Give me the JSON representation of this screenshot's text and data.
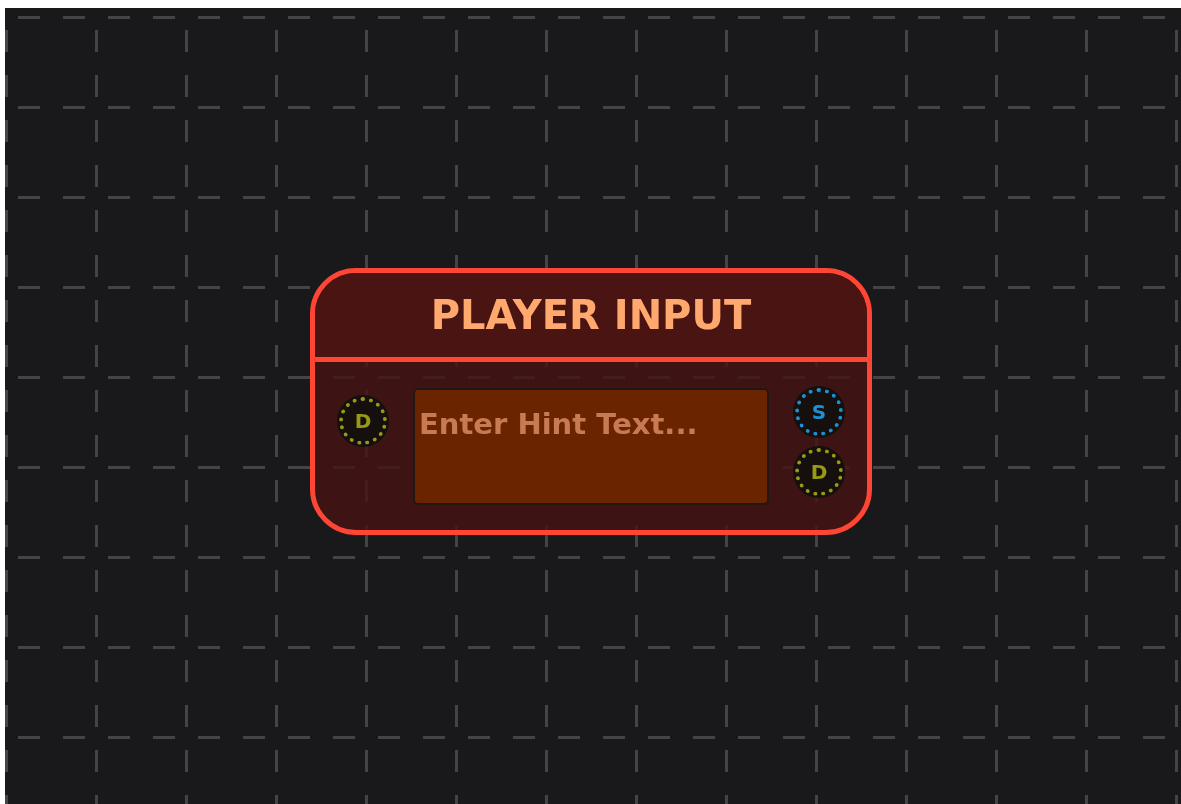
{
  "node": {
    "title": "PLAYER INPUT",
    "input": {
      "placeholder": "Enter Hint Text..."
    },
    "inputs": [
      {
        "label": "D",
        "kind": "data"
      }
    ],
    "outputs": [
      {
        "label": "S",
        "kind": "signal"
      },
      {
        "label": "D",
        "kind": "data"
      }
    ]
  }
}
